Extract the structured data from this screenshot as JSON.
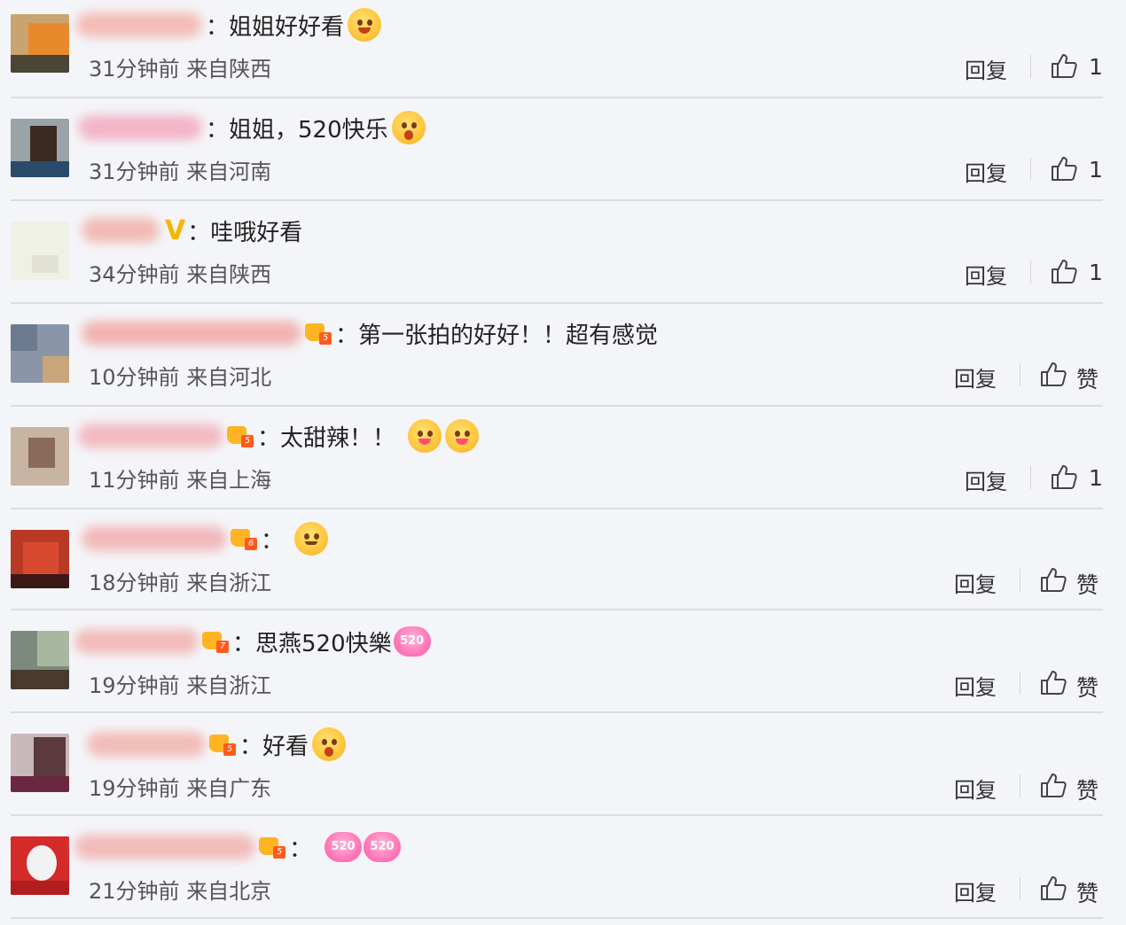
{
  "comments": [
    {
      "text": "姐姐好好看",
      "time": "31分钟前",
      "location": "来自陕西",
      "reply": "回复",
      "like": "1",
      "emojis": [
        "smile-emoji"
      ]
    },
    {
      "text": "姐姐，520快乐",
      "time": "31分钟前",
      "location": "来自河南",
      "reply": "回复",
      "like": "1",
      "emojis": [
        "scream-emoji"
      ]
    },
    {
      "text": "哇哦好看",
      "time": "34分钟前",
      "location": "来自陕西",
      "reply": "回复",
      "like": "1",
      "emojis": []
    },
    {
      "text": "第一张拍的好好！！超有感觉",
      "time": "10分钟前",
      "location": "来自河北",
      "reply": "回复",
      "like": "赞",
      "emojis": []
    },
    {
      "text": "太甜辣！！",
      "time": "11分钟前",
      "location": "来自上海",
      "reply": "回复",
      "like": "1",
      "emojis": [
        "kiss-emoji",
        "kiss-emoji"
      ]
    },
    {
      "text": "",
      "time": "18分钟前",
      "location": "来自浙江",
      "reply": "回复",
      "like": "赞",
      "emojis": [
        "smile-emoji"
      ]
    },
    {
      "text": "思燕520快樂",
      "time": "19分钟前",
      "location": "来自浙江",
      "reply": "回复",
      "like": "赞",
      "emojis": [
        "heart-520"
      ]
    },
    {
      "text": "好看",
      "time": "19分钟前",
      "location": "来自广东",
      "reply": "回复",
      "like": "赞",
      "emojis": [
        "scream-emoji"
      ]
    },
    {
      "text": "",
      "time": "21分钟前",
      "location": "来自北京",
      "reply": "回复",
      "like": "赞",
      "emojis": [
        "heart-520",
        "heart-520"
      ]
    }
  ],
  "colon": "：",
  "v_badge": "V",
  "heart_label": "520",
  "colors": {
    "background": "#f4f5f9",
    "divider": "#dcdde2",
    "text": "#222222",
    "meta": "#555555",
    "vip_crown": "#ffb423",
    "vip_level": "#ff5a1e"
  }
}
